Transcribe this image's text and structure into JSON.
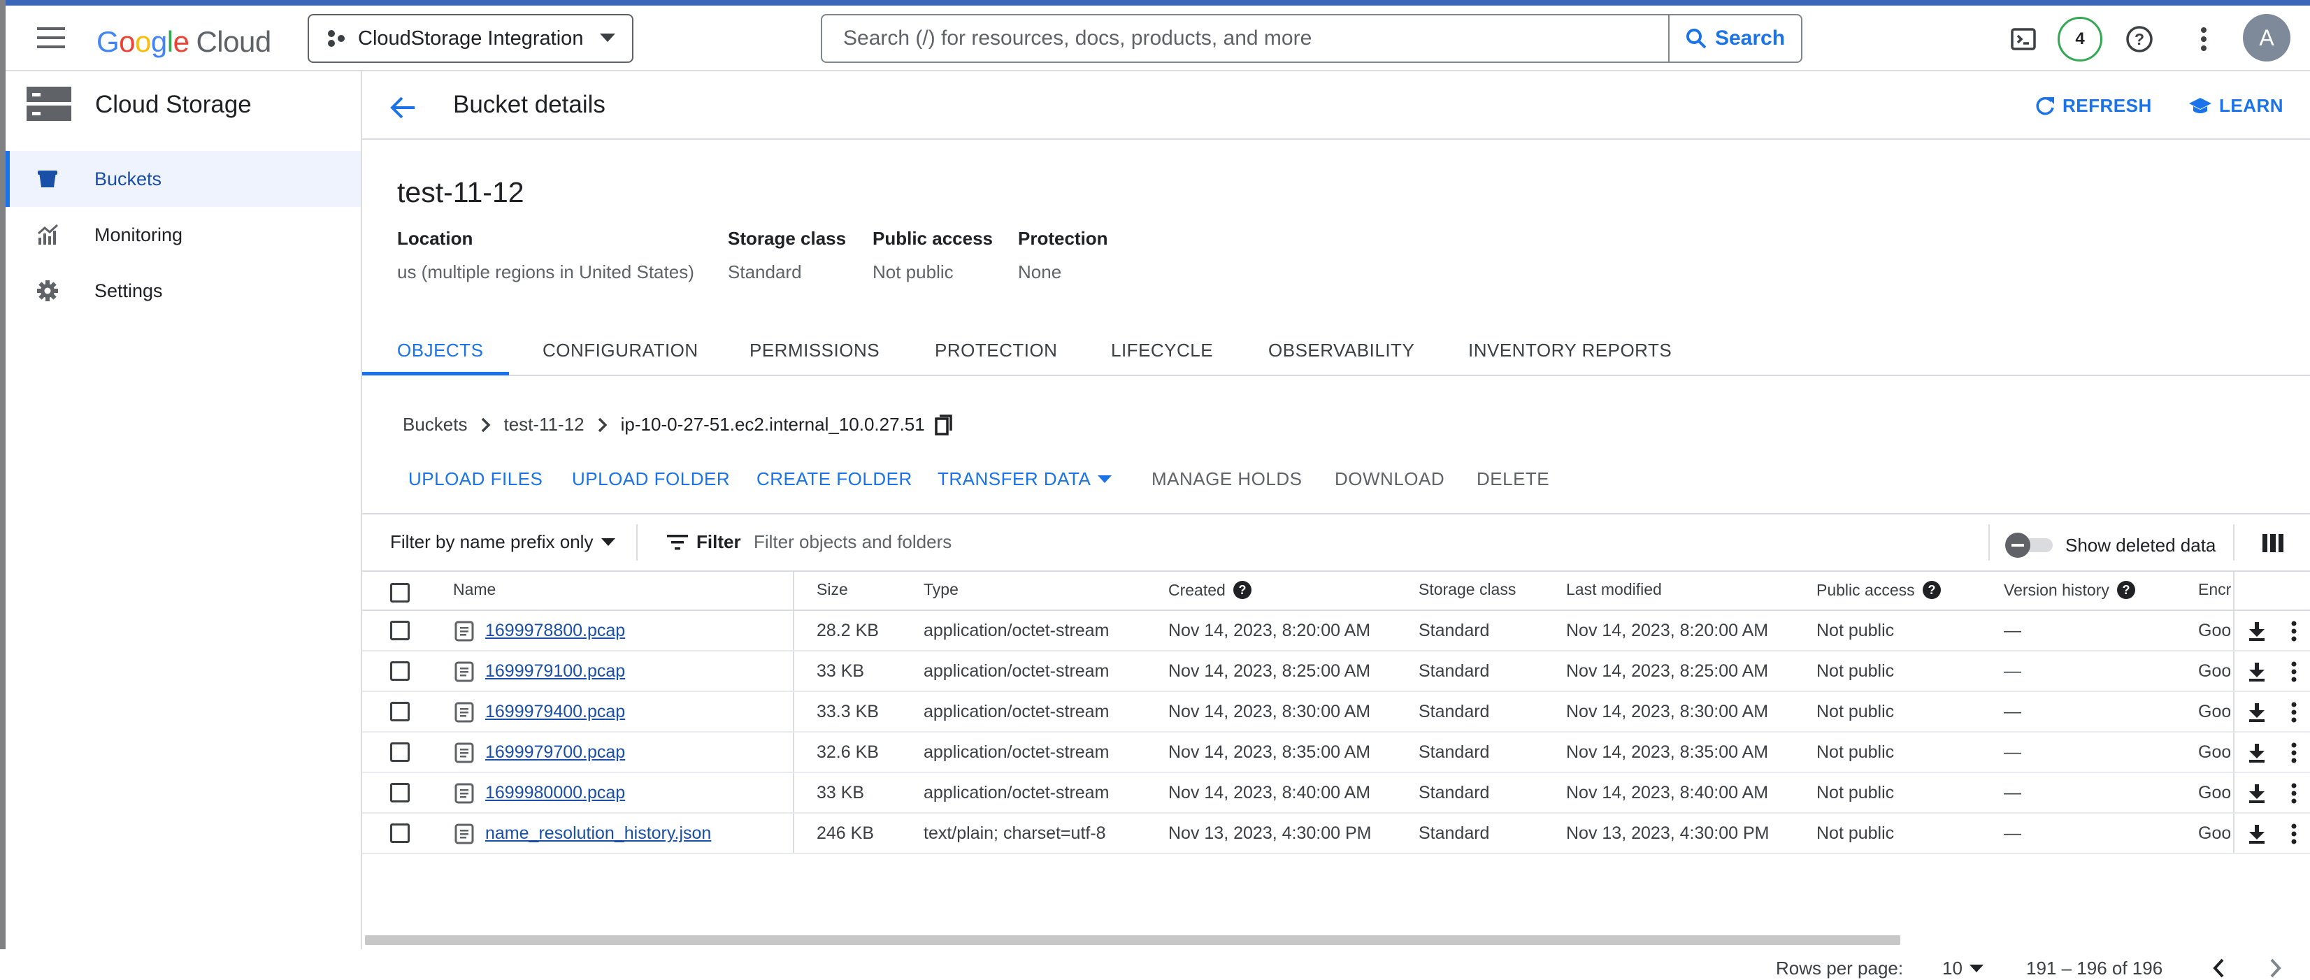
{
  "topbar": {
    "logo_google": [
      "G",
      "o",
      "o",
      "g",
      "l",
      "e"
    ],
    "logo_cloud": "Cloud",
    "project": "CloudStorage Integration",
    "search_placeholder": "Search (/) for resources, docs, products, and more",
    "search_button": "Search",
    "notifications_count": "4",
    "avatar_initial": "A"
  },
  "sidebar": {
    "title": "Cloud Storage",
    "items": [
      {
        "label": "Buckets",
        "icon": "bucket-icon",
        "active": true
      },
      {
        "label": "Monitoring",
        "icon": "monitoring-icon",
        "active": false
      },
      {
        "label": "Settings",
        "icon": "gear-icon",
        "active": false
      }
    ]
  },
  "header": {
    "title": "Bucket details",
    "refresh": "REFRESH",
    "learn": "LEARN"
  },
  "bucket": {
    "name": "test-11-12",
    "location_label": "Location",
    "location_value": "us (multiple regions in United States)",
    "storage_class_label": "Storage class",
    "storage_class_value": "Standard",
    "public_access_label": "Public access",
    "public_access_value": "Not public",
    "protection_label": "Protection",
    "protection_value": "None"
  },
  "tabs": [
    "OBJECTS",
    "CONFIGURATION",
    "PERMISSIONS",
    "PROTECTION",
    "LIFECYCLE",
    "OBSERVABILITY",
    "INVENTORY REPORTS"
  ],
  "breadcrumb": [
    "Buckets",
    "test-11-12",
    "ip-10-0-27-51.ec2.internal_10.0.27.51"
  ],
  "actions": {
    "upload_files": "UPLOAD FILES",
    "upload_folder": "UPLOAD FOLDER",
    "create_folder": "CREATE FOLDER",
    "transfer_data": "TRANSFER DATA",
    "manage_holds": "MANAGE HOLDS",
    "download": "DOWNLOAD",
    "delete": "DELETE"
  },
  "filter": {
    "mode": "Filter by name prefix only",
    "filter_label": "Filter",
    "placeholder": "Filter objects and folders",
    "show_deleted": "Show deleted data"
  },
  "table": {
    "columns": [
      "Name",
      "Size",
      "Type",
      "Created",
      "Storage class",
      "Last modified",
      "Public access",
      "Version history",
      "Encr"
    ],
    "rows": [
      {
        "name": "1699978800.pcap",
        "size": "28.2 KB",
        "type": "application/octet-stream",
        "created": "Nov 14, 2023, 8:20:00 AM",
        "storage_class": "Standard",
        "last_modified": "Nov 14, 2023, 8:20:00 AM",
        "public_access": "Not public",
        "version_history": "—",
        "encryption": "Goo"
      },
      {
        "name": "1699979100.pcap",
        "size": "33 KB",
        "type": "application/octet-stream",
        "created": "Nov 14, 2023, 8:25:00 AM",
        "storage_class": "Standard",
        "last_modified": "Nov 14, 2023, 8:25:00 AM",
        "public_access": "Not public",
        "version_history": "—",
        "encryption": "Goo"
      },
      {
        "name": "1699979400.pcap",
        "size": "33.3 KB",
        "type": "application/octet-stream",
        "created": "Nov 14, 2023, 8:30:00 AM",
        "storage_class": "Standard",
        "last_modified": "Nov 14, 2023, 8:30:00 AM",
        "public_access": "Not public",
        "version_history": "—",
        "encryption": "Goo"
      },
      {
        "name": "1699979700.pcap",
        "size": "32.6 KB",
        "type": "application/octet-stream",
        "created": "Nov 14, 2023, 8:35:00 AM",
        "storage_class": "Standard",
        "last_modified": "Nov 14, 2023, 8:35:00 AM",
        "public_access": "Not public",
        "version_history": "—",
        "encryption": "Goo"
      },
      {
        "name": "1699980000.pcap",
        "size": "33 KB",
        "type": "application/octet-stream",
        "created": "Nov 14, 2023, 8:40:00 AM",
        "storage_class": "Standard",
        "last_modified": "Nov 14, 2023, 8:40:00 AM",
        "public_access": "Not public",
        "version_history": "—",
        "encryption": "Goo"
      },
      {
        "name": "name_resolution_history.json",
        "size": "246 KB",
        "type": "text/plain; charset=utf-8",
        "created": "Nov 13, 2023, 4:30:00 PM",
        "storage_class": "Standard",
        "last_modified": "Nov 13, 2023, 4:30:00 PM",
        "public_access": "Not public",
        "version_history": "—",
        "encryption": "Goo"
      }
    ]
  },
  "pagination": {
    "rows_per_page_label": "Rows per page:",
    "rows_per_page": "10",
    "range": "191 – 196 of 196"
  },
  "colors": {
    "accent": "#1a73e8",
    "top_border": "#3c66b8",
    "active_nav_bg": "#eef3fd"
  }
}
